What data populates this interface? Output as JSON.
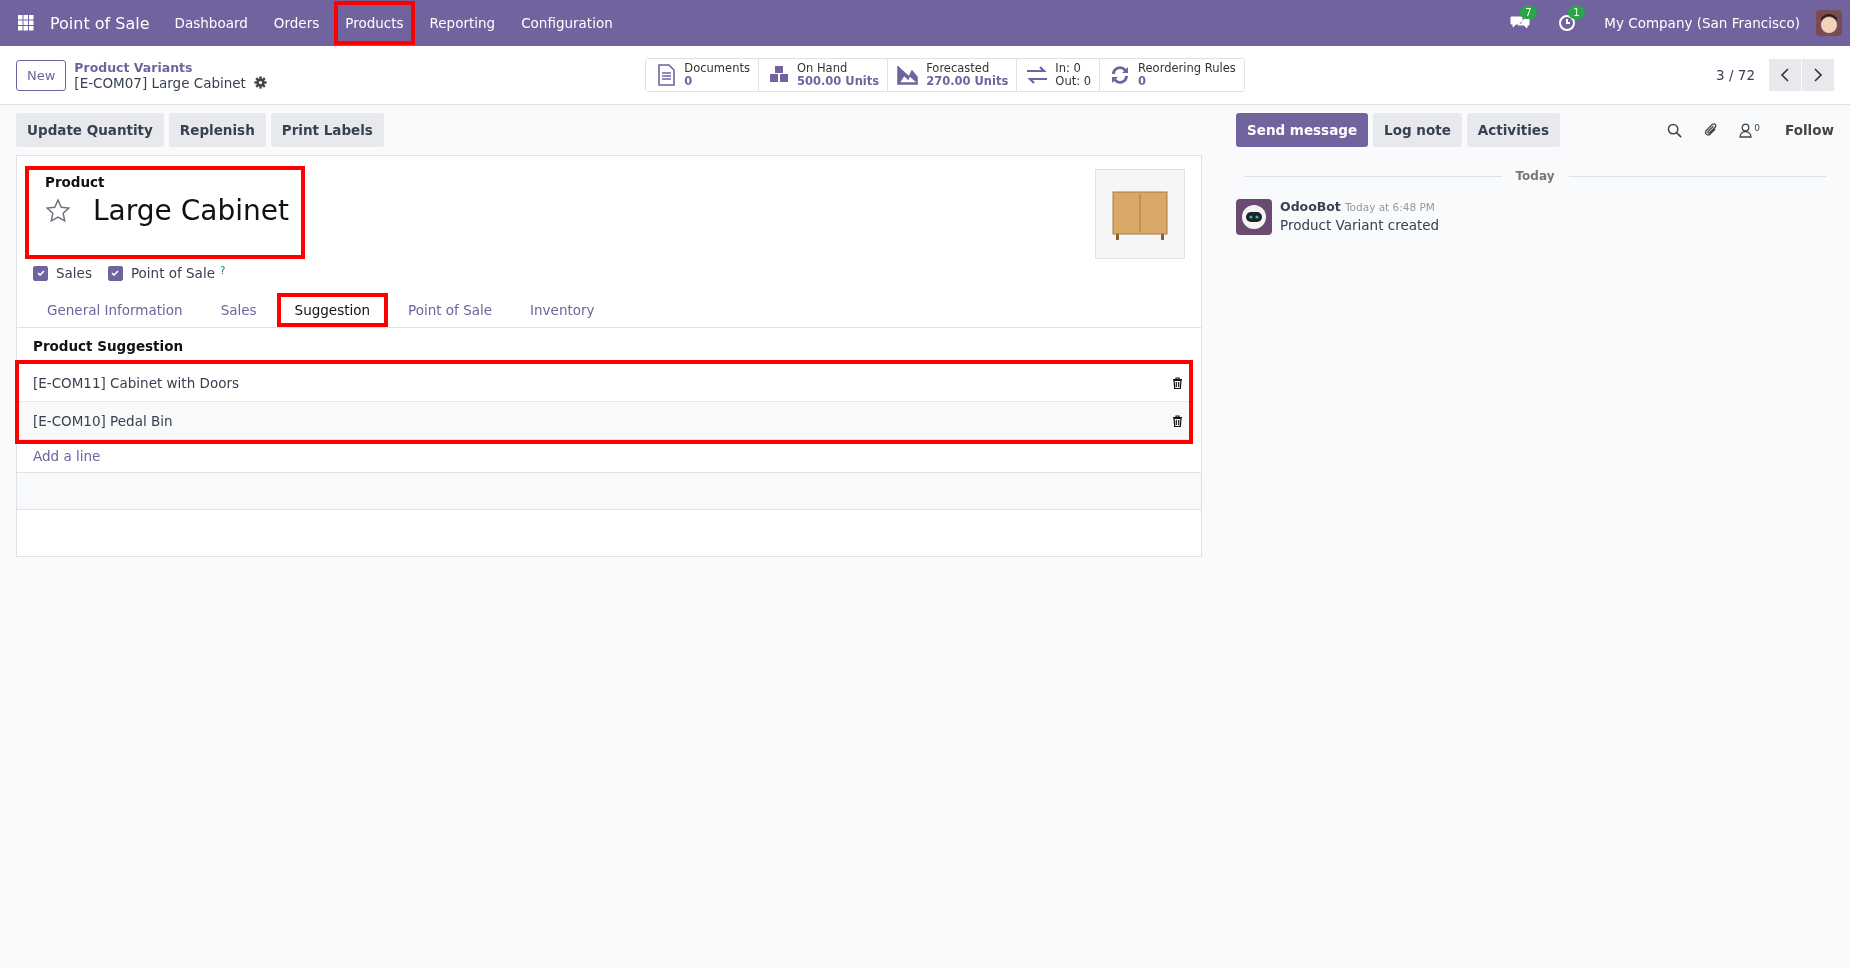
{
  "navbar": {
    "app_name": "Point of Sale",
    "menu": [
      {
        "label": "Dashboard",
        "highlighted": false
      },
      {
        "label": "Orders",
        "highlighted": false
      },
      {
        "label": "Products",
        "highlighted": true
      },
      {
        "label": "Reporting",
        "highlighted": false
      },
      {
        "label": "Configuration",
        "highlighted": false
      }
    ],
    "messages_badge": "7",
    "activities_badge": "1",
    "company": "My Company (San Francisco)"
  },
  "control_panel": {
    "new_button": "New",
    "breadcrumb": "Product Variants",
    "record_name": "[E-COM07] Large Cabinet",
    "stat_buttons": [
      {
        "kind": "stat",
        "label": "Documents",
        "value": "0"
      },
      {
        "kind": "stat",
        "label": "On Hand",
        "value": "500.00 Units"
      },
      {
        "kind": "stat",
        "label": "Forecasted",
        "value": "270.00 Units"
      },
      {
        "kind": "inout",
        "label": "In: 0",
        "value": "Out: 0"
      },
      {
        "kind": "stat",
        "label": "Reordering Rules",
        "value": "0"
      }
    ],
    "pager": "3 / 72"
  },
  "action_buttons": [
    "Update Quantity",
    "Replenish",
    "Print Labels"
  ],
  "form": {
    "title_label": "Product",
    "name": "Large Cabinet",
    "favorite": false,
    "title_highlighted": true,
    "checkboxes": [
      {
        "label": "Sales",
        "checked": true
      },
      {
        "label": "Point of Sale",
        "checked": true,
        "help": "?"
      }
    ],
    "tabs": [
      {
        "label": "General Information",
        "selected": false,
        "highlighted": false
      },
      {
        "label": "Sales",
        "selected": false,
        "highlighted": false
      },
      {
        "label": "Suggestion",
        "selected": true,
        "highlighted": true
      },
      {
        "label": "Point of Sale",
        "selected": false,
        "highlighted": false
      },
      {
        "label": "Inventory",
        "selected": false,
        "highlighted": false
      }
    ],
    "section_title": "Product Suggestion",
    "lines_highlighted": true,
    "lines": [
      "[E-COM11] Cabinet with Doors",
      "[E-COM10] Pedal Bin"
    ],
    "add_line": "Add a line"
  },
  "chatter": {
    "buttons": [
      {
        "label": "Send message",
        "selected": true
      },
      {
        "label": "Log note",
        "selected": false
      },
      {
        "label": "Activities",
        "selected": false
      }
    ],
    "followers_count": "0",
    "follow": "Follow",
    "date_separator": "Today",
    "messages": [
      {
        "author": "OdooBot",
        "time": "Today at 6:48 PM",
        "body": "Product Variant created"
      }
    ]
  }
}
